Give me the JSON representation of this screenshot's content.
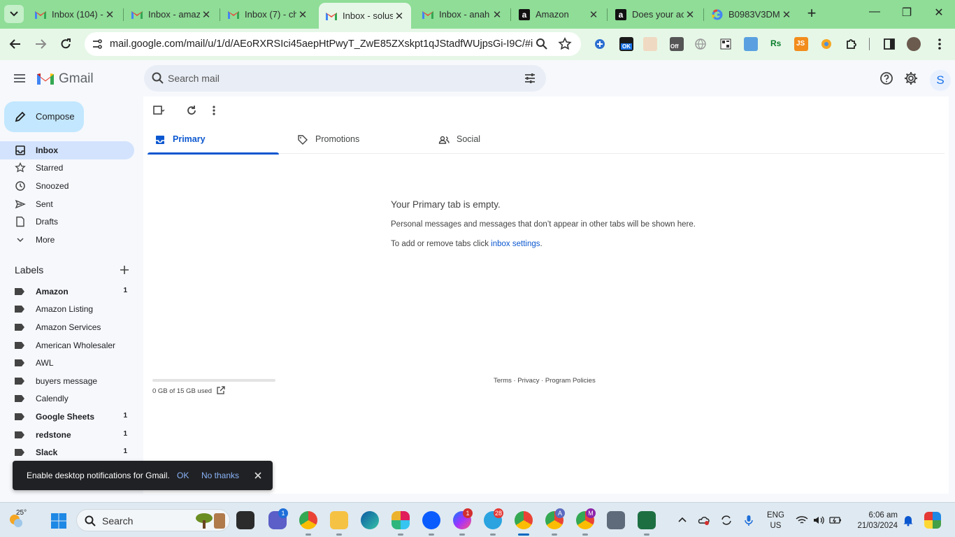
{
  "browser": {
    "tabs": [
      {
        "title": "Inbox (104) -",
        "icon": "gmail-icon"
      },
      {
        "title": "Inbox - amaz",
        "icon": "gmail-icon"
      },
      {
        "title": "Inbox (7) - ch",
        "icon": "gmail-icon"
      },
      {
        "title": "Inbox - solus",
        "icon": "gmail-icon",
        "active": true
      },
      {
        "title": "Inbox - anah",
        "icon": "gmail-icon"
      },
      {
        "title": "Amazon",
        "icon": "amazon-icon"
      },
      {
        "title": "Does your ac",
        "icon": "amazon-icon"
      },
      {
        "title": "B0983V3DM",
        "icon": "google-icon"
      }
    ],
    "close_glyph": "✕",
    "new_tab_glyph": "+",
    "url": "mail.google.com/mail/u/1/d/AEoRXRSIci45aepHtPwyT_ZwE85ZXskpt1qJStadfWUjpsGi-I9C/#inbox",
    "window_controls": {
      "minimize": "—",
      "restore": "❐",
      "close": "✕"
    },
    "extension_badges": {
      "ok": "OK",
      "off": "Off",
      "js": "JS",
      "rs": "Rs"
    }
  },
  "gmail": {
    "logo_text": "Gmail",
    "search_placeholder": "Search mail",
    "avatar_letter": "S",
    "compose_label": "Compose",
    "nav": [
      {
        "label": "Inbox",
        "icon": "inbox-icon",
        "active": true
      },
      {
        "label": "Starred",
        "icon": "star-icon"
      },
      {
        "label": "Snoozed",
        "icon": "clock-icon"
      },
      {
        "label": "Sent",
        "icon": "send-icon"
      },
      {
        "label": "Drafts",
        "icon": "draft-icon"
      },
      {
        "label": "More",
        "icon": "chevron-down-icon"
      }
    ],
    "labels_heading": "Labels",
    "labels": [
      {
        "label": "Amazon",
        "count": "1",
        "bold": true
      },
      {
        "label": "Amazon Listing",
        "count": "",
        "bold": false
      },
      {
        "label": "Amazon Services",
        "count": "",
        "bold": false
      },
      {
        "label": "American Wholesaler",
        "count": "",
        "bold": false
      },
      {
        "label": "AWL",
        "count": "",
        "bold": false
      },
      {
        "label": "buyers message",
        "count": "",
        "bold": false
      },
      {
        "label": "Calendly",
        "count": "",
        "bold": false
      },
      {
        "label": "Google Sheets",
        "count": "1",
        "bold": true
      },
      {
        "label": "redstone",
        "count": "1",
        "bold": true
      },
      {
        "label": "Slack",
        "count": "1",
        "bold": true
      }
    ],
    "category_tabs": [
      {
        "label": "Primary",
        "icon": "inbox-icon",
        "active": true
      },
      {
        "label": "Promotions",
        "icon": "tag-icon"
      },
      {
        "label": "Social",
        "icon": "people-icon"
      }
    ],
    "empty_state": {
      "title": "Your Primary tab is empty.",
      "description": "Personal messages and messages that don’t appear in other tabs will be shown here.",
      "hint_prefix": "To add or remove tabs click ",
      "hint_link": "inbox settings",
      "hint_suffix": "."
    },
    "storage": {
      "text": "0 GB of 15 GB used",
      "fraction_used": 0.0
    },
    "footer": "Terms · Privacy · Program Policies",
    "snackbar": {
      "message": "Enable desktop notifications for Gmail.",
      "ok": "OK",
      "no_thanks": "No thanks"
    }
  },
  "taskbar": {
    "weather_temp": "25°",
    "search_label": "Search",
    "badges": {
      "teams": "1",
      "messenger": "1",
      "telegram": "28",
      "chrome_a": "A",
      "chrome_m": "M"
    },
    "language_line1": "ENG",
    "language_line2": "US",
    "time": "6:06 am",
    "date": "21/03/2024"
  },
  "colors": {
    "tabstrip": "#8fdd97",
    "toolbar": "#e6f7e7",
    "gmail_bg": "#f6f8fc",
    "compose": "#c2e7ff",
    "active_nav": "#d3e3fd",
    "accent": "#0b57d0"
  }
}
